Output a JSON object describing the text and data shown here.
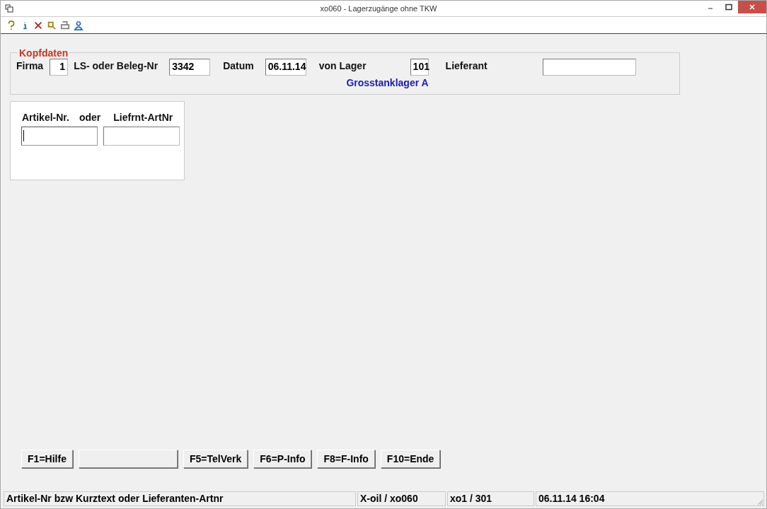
{
  "window": {
    "title": "xo060 - Lagerzugänge ohne TKW"
  },
  "toolbar": [
    {
      "kind": "help"
    },
    {
      "kind": "info"
    },
    {
      "kind": "delete"
    },
    {
      "kind": "search"
    },
    {
      "kind": "print"
    },
    {
      "kind": "user"
    }
  ],
  "kopfdaten": {
    "legend": "Kopfdaten",
    "fields": [
      {
        "label": "Firma",
        "value": "1"
      },
      {
        "label": "LS- oder Beleg-Nr",
        "value": "3342"
      },
      {
        "label": "Datum",
        "value": "06.11.14"
      },
      {
        "label": "von Lager",
        "value": "101",
        "note": "Grosstanklager A"
      },
      {
        "label": "Lieferant"
      }
    ]
  },
  "artikel": {
    "labels": [
      "Artikel-Nr.",
      "oder",
      "Liefrnt-ArtNr"
    ],
    "fields": [
      {
        "focused": true
      },
      {
        "focused": false
      }
    ]
  },
  "buttons": [
    {
      "kind": "key",
      "label": "F1=Hilfe"
    },
    {
      "kind": "blank"
    },
    {
      "kind": "key",
      "label": "F5=TelVerk"
    },
    {
      "kind": "key",
      "label": "F6=P-Info"
    },
    {
      "kind": "key",
      "label": "F8=F-Info"
    },
    {
      "kind": "key",
      "label": "F10=Ende"
    }
  ],
  "status_bar": [
    "Artikel-Nr bzw Kurztext oder Lieferanten-Artnr",
    "X-oil / xo060",
    "xo1 / 301",
    "06.11.14 16:04"
  ]
}
